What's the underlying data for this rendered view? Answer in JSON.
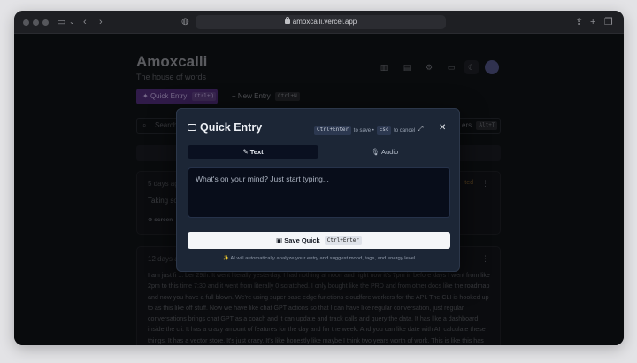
{
  "browser": {
    "url": "amoxcalli.vercel.app"
  },
  "app": {
    "title": "Amoxcalli",
    "subtitle": "The house of words",
    "quick_entry_label": "Quick Entry",
    "quick_entry_shortcut": "Ctrl+Q",
    "new_entry_label": "New Entry",
    "new_entry_shortcut": "Ctrl+N",
    "search_placeholder": "Search",
    "filters_label": "ers",
    "filters_shortcut": "Alt+T"
  },
  "entries": [
    {
      "meta": "5 days ago",
      "snippet": "Taking sor",
      "tag": "screen",
      "flag": "ted"
    },
    {
      "meta": "12 days ago",
      "text": "I am just fi ... ber 29th. It went literally yesterday. I had nothing at noon and right now it's 7pm in before days I went from like 2pm to this time 7:30 and it went from literally 0 scratched. I only bought like the PRD and from other docs like the roadmap and now you have a full blown. We're using super base edge functions cloudfare workers for the API. The CLI is hooked up to as this like off stuff. Now we have like chat GPT actions so that I can have like regular conversation, just regular conversations brings chat GPT as a coach and it can update and track calls and query the data. It has like a dashboard inside the cli. It has a crazy amount of features for the day and for the week. And you can like date with AI, calculate these things. It has a vector store. It's just crazy. It's like honestly like maybe I think two years worth of work. This is like this has gone from me working on and making like a working demo, you know, issues and like very like barely a POC to three fully grown pools and applications"
    }
  ],
  "modal": {
    "title": "Quick Entry",
    "hint_save_key": "Ctrl+Enter",
    "hint_save_text": "to save •",
    "hint_cancel_key": "Esc",
    "hint_cancel_text": "to cancel",
    "tab_text": "Text",
    "tab_audio": "Audio",
    "input_placeholder": "What's on your mind? Just start typing...",
    "save_label": "Save Quick",
    "save_shortcut": "Ctrl+Enter",
    "note": "✨ AI will automatically analyze your entry and suggest mood, tags, and energy level"
  }
}
